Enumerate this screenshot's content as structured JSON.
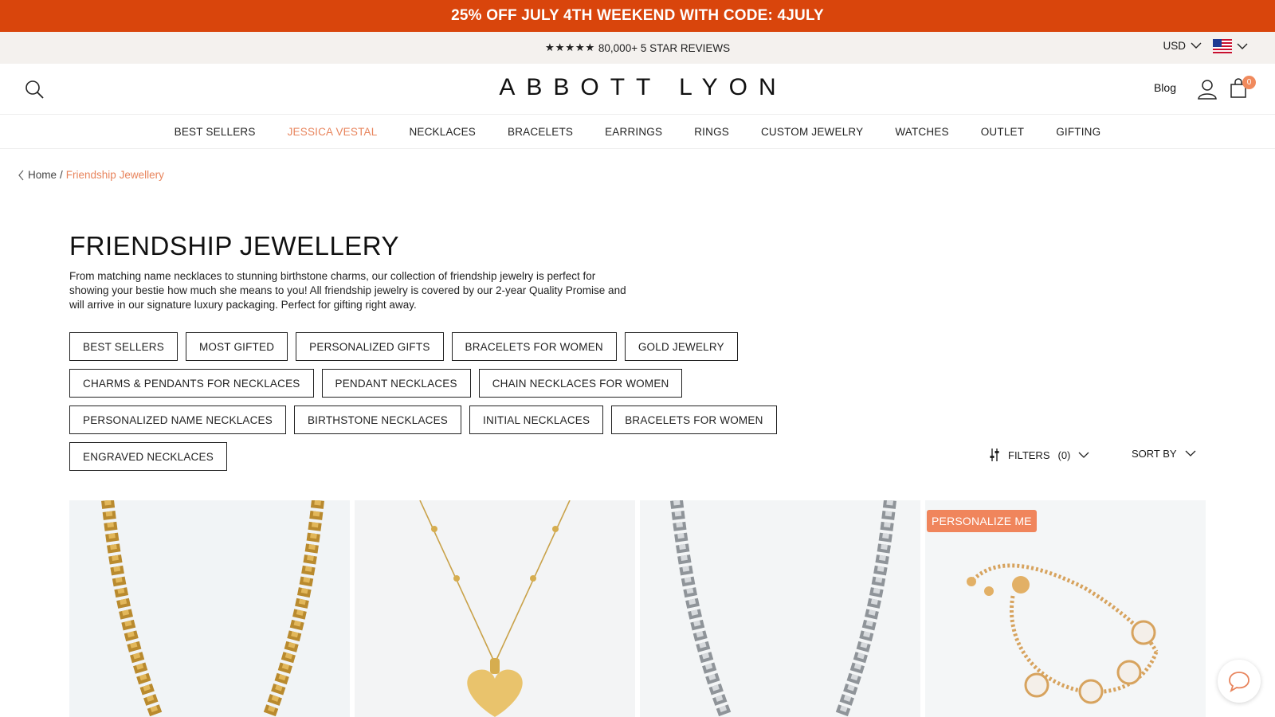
{
  "promo": {
    "text": "25% OFF JULY 4TH WEEKEND WITH CODE: 4JULY"
  },
  "reviews": {
    "stars": "★★★★★",
    "text": "80,000+ 5 STAR REVIEWS"
  },
  "locale": {
    "currency": "USD",
    "country_flag": "us-flag-icon"
  },
  "header": {
    "logo": "ABBOTT LYON",
    "blog": "Blog",
    "cart_count": "0"
  },
  "nav": [
    {
      "label": "BEST SELLERS"
    },
    {
      "label": "JESSICA VESTAL",
      "accent": true
    },
    {
      "label": "NECKLACES"
    },
    {
      "label": "BRACELETS"
    },
    {
      "label": "EARRINGS"
    },
    {
      "label": "RINGS"
    },
    {
      "label": "CUSTOM JEWELRY"
    },
    {
      "label": "WATCHES"
    },
    {
      "label": "OUTLET"
    },
    {
      "label": "GIFTING"
    }
  ],
  "breadcrumb": {
    "home": "Home",
    "separator": "/",
    "current": "Friendship Jewellery"
  },
  "page": {
    "title": "FRIENDSHIP JEWELLERY",
    "intro": "From matching name necklaces to stunning birthstone charms, our collection of friendship jewelry is perfect for showing your bestie how much she means to you! All friendship jewelry is covered by our 2-year Quality Promise and will arrive in our signature luxury packaging. Perfect for gifting right away."
  },
  "chips": [
    [
      "BEST SELLERS",
      "MOST GIFTED",
      "PERSONALIZED GIFTS",
      "BRACELETS FOR WOMEN",
      "GOLD JEWELRY"
    ],
    [
      "CHARMS & PENDANTS FOR NECKLACES",
      "PENDANT NECKLACES",
      "CHAIN NECKLACES FOR WOMEN"
    ],
    [
      "PERSONALIZED NAME NECKLACES",
      "BIRTHSTONE NECKLACES",
      "INITIAL NECKLACES",
      "BRACELETS FOR WOMEN"
    ],
    [
      "ENGRAVED NECKLACES"
    ]
  ],
  "toolbar": {
    "filters_label": "FILTERS",
    "filters_count": "(0)",
    "sort_label": "SORT BY"
  },
  "products": [
    {
      "image": "gold-curb-chain-necklace",
      "badge": ""
    },
    {
      "image": "gold-heart-pendant-necklace",
      "badge": ""
    },
    {
      "image": "silver-curb-chain-necklace",
      "badge": ""
    },
    {
      "image": "gold-clover-charm-bracelet",
      "badge": "PERSONALIZE ME"
    }
  ],
  "colors": {
    "promo": "#d9450c",
    "accent": "#e8845c",
    "badge": "#f0855c"
  }
}
